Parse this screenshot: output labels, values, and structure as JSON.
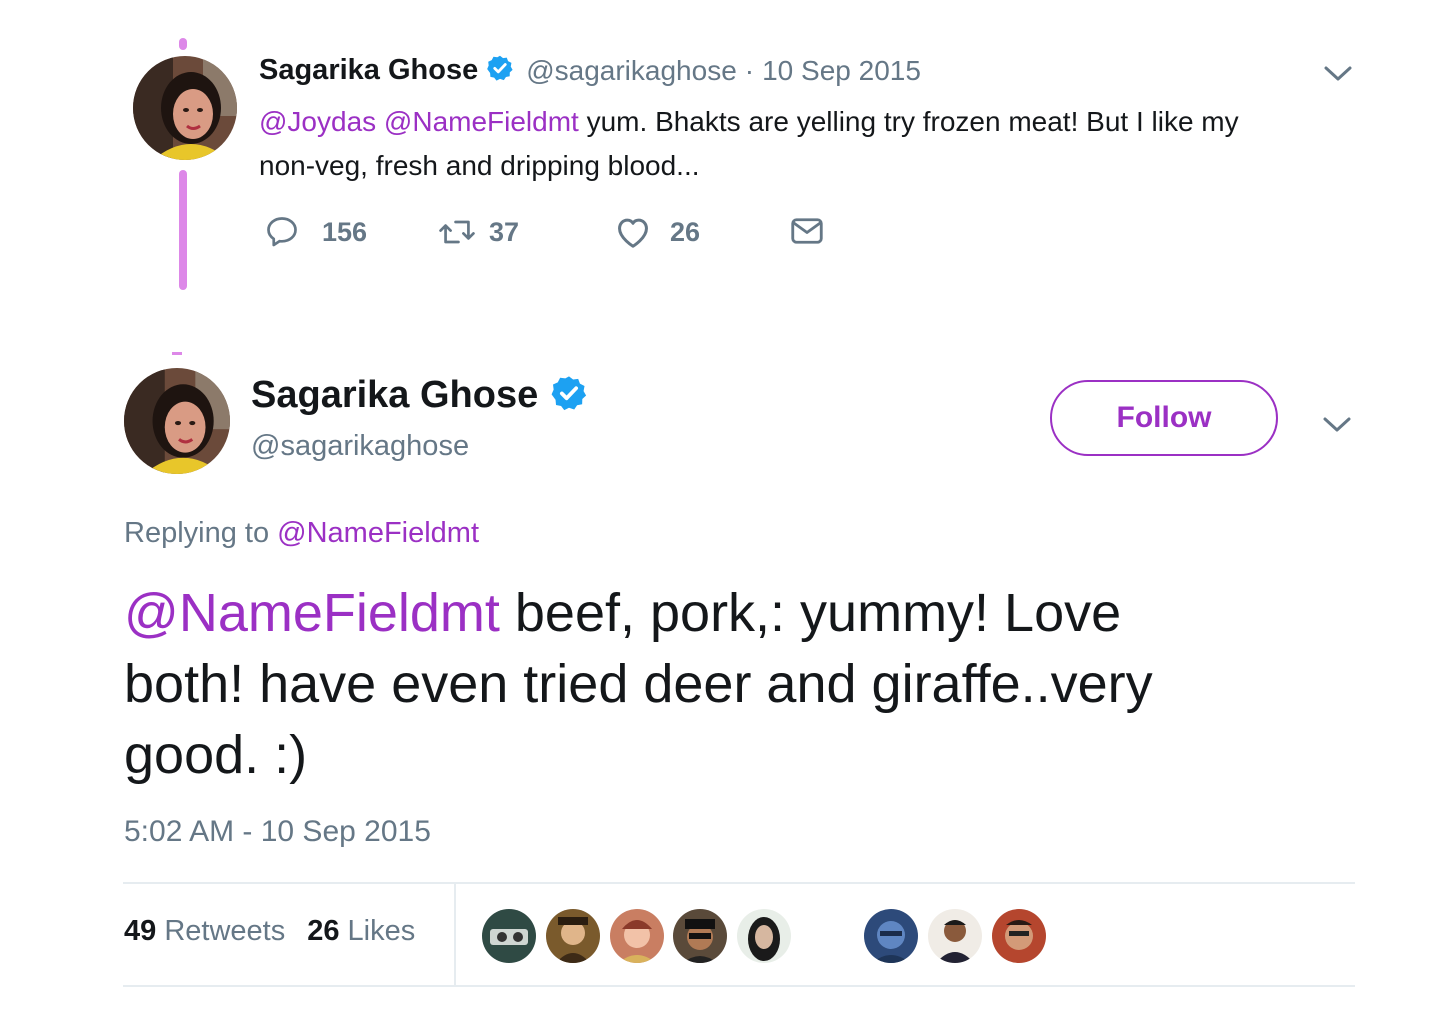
{
  "tweet1": {
    "name": "Sagarika Ghose",
    "handle": "@sagarikaghose",
    "separator": "·",
    "date": "10 Sep 2015",
    "mention1": "@Joydas",
    "mention2": "@NameFieldmt",
    "text_line1": " yum. Bhakts are yelling try frozen meat! But I like my",
    "text_line2": "non-veg,  fresh and dripping blood...",
    "replies": "156",
    "retweets": "37",
    "likes": "26"
  },
  "tweet2": {
    "name": "Sagarika Ghose",
    "handle": "@sagarikaghose",
    "follow_label": "Follow",
    "replying_prefix": "Replying to ",
    "replying_handle": "@NameFieldmt",
    "mention": "@NameFieldmt",
    "text_line1_rest": " beef, pork,: yummy! Love",
    "text_line2": "both! have even tried deer and giraffe..very",
    "text_line3": "good. :)",
    "timestamp": "5:02 AM - 10 Sep 2015",
    "retweets_count": "49",
    "retweets_label": " Retweets",
    "likes_count": "26",
    "likes_label": " Likes"
  },
  "colors": {
    "accent": "#9b30c4",
    "thread_line": "#dd88e8",
    "verified": "#1da1f2",
    "muted": "#657786"
  }
}
